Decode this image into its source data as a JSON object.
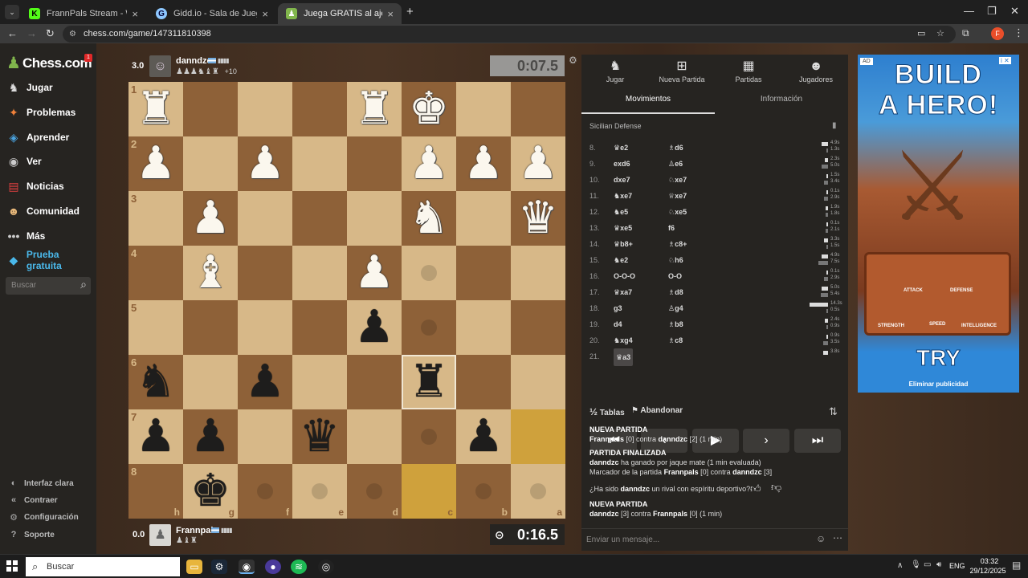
{
  "browser": {
    "tabs": [
      {
        "title": "FrannPals Stream - Watch Live o",
        "icon": "kick-icon",
        "color": "#53fc18"
      },
      {
        "title": "Gidd.io - Sala de Juegos de Fra",
        "icon": "giddio-icon",
        "color": "#8ec8ff"
      },
      {
        "title": "Juega GRATIS al ajedrez online",
        "icon": "chess-pawn-icon",
        "color": "#81b64c"
      }
    ],
    "url": "chess.com/game/147311810398",
    "profile_letter": "F"
  },
  "sidebar": {
    "logo": "Chess.com",
    "notif_badge": "1",
    "items": [
      {
        "label": "Jugar",
        "icon": "play-icon"
      },
      {
        "label": "Problemas",
        "icon": "puzzle-icon"
      },
      {
        "label": "Aprender",
        "icon": "learn-icon"
      },
      {
        "label": "Ver",
        "icon": "watch-icon"
      },
      {
        "label": "Noticias",
        "icon": "news-icon"
      },
      {
        "label": "Comunidad",
        "icon": "community-icon"
      },
      {
        "label": "Más",
        "icon": "more-icon"
      },
      {
        "label": "Prueba gratuita",
        "icon": "diamond-icon"
      }
    ],
    "search_placeholder": "Buscar",
    "bottom": [
      {
        "label": "Interfaz clara",
        "icon": "light-mode-icon"
      },
      {
        "label": "Contraer",
        "icon": "collapse-icon"
      },
      {
        "label": "Configuración",
        "icon": "settings-icon"
      },
      {
        "label": "Soporte",
        "icon": "help-icon"
      }
    ]
  },
  "top_player": {
    "name": "danndzc",
    "eval": "3.0",
    "clock": "0:07.5",
    "captured_extra": "+10"
  },
  "bottom_player": {
    "name": "Frannpals",
    "eval": "0.0",
    "clock": "0:16.5"
  },
  "board": {
    "rank_labels": [
      "1",
      "2",
      "3",
      "4",
      "5",
      "6",
      "7",
      "8"
    ],
    "file_labels": [
      "h",
      "g",
      "f",
      "e",
      "d",
      "c",
      "b",
      "a"
    ],
    "pieces": [
      {
        "sq": "0-0",
        "p": "♜",
        "c": "w"
      },
      {
        "sq": "0-4",
        "p": "♜",
        "c": "w"
      },
      {
        "sq": "0-5",
        "p": "♚",
        "c": "w"
      },
      {
        "sq": "1-0",
        "p": "♟",
        "c": "w"
      },
      {
        "sq": "1-2",
        "p": "♟",
        "c": "w"
      },
      {
        "sq": "1-5",
        "p": "♟",
        "c": "w"
      },
      {
        "sq": "1-6",
        "p": "♟",
        "c": "w"
      },
      {
        "sq": "1-7",
        "p": "♟",
        "c": "w"
      },
      {
        "sq": "2-1",
        "p": "♟",
        "c": "w"
      },
      {
        "sq": "2-5",
        "p": "♞",
        "c": "w"
      },
      {
        "sq": "2-7",
        "p": "♛",
        "c": "w"
      },
      {
        "sq": "3-1",
        "p": "♝",
        "c": "w"
      },
      {
        "sq": "3-4",
        "p": "♟",
        "c": "w"
      },
      {
        "sq": "4-4",
        "p": "♟",
        "c": "b"
      },
      {
        "sq": "5-0",
        "p": "♞",
        "c": "b"
      },
      {
        "sq": "5-2",
        "p": "♟",
        "c": "b"
      },
      {
        "sq": "5-5",
        "p": "♜",
        "c": "b"
      },
      {
        "sq": "6-0",
        "p": "♟",
        "c": "b"
      },
      {
        "sq": "6-1",
        "p": "♟",
        "c": "b"
      },
      {
        "sq": "6-3",
        "p": "♛",
        "c": "b"
      },
      {
        "sq": "6-6",
        "p": "♟",
        "c": "b"
      },
      {
        "sq": "7-1",
        "p": "♚",
        "c": "b"
      }
    ],
    "highlight": [
      "7-5",
      "6-7"
    ],
    "selected": "5-5",
    "hints": [
      "3-5",
      "4-5",
      "6-5",
      "7-3",
      "7-4",
      "7-6",
      "7-7",
      "7-2"
    ]
  },
  "panel": {
    "tabs": [
      {
        "label": "Jugar",
        "icon": "play-icon"
      },
      {
        "label": "Nueva Partida",
        "icon": "plus-icon"
      },
      {
        "label": "Partidas",
        "icon": "board-icon"
      },
      {
        "label": "Jugadores",
        "icon": "players-icon"
      }
    ],
    "subtabs": [
      "Movimientos",
      "Información"
    ],
    "opening": "Sicilian Defense",
    "moves": [
      {
        "n": "8.",
        "w": "♛e2",
        "b": "♗d6",
        "t1": "4.9s",
        "t2": "1.3s"
      },
      {
        "n": "9.",
        "w": "exd6",
        "b": "♙e6",
        "t1": "2.3s",
        "t2": "5.0s"
      },
      {
        "n": "10.",
        "w": "dxe7",
        "b": "♘xe7",
        "t1": "1.5s",
        "t2": "3.4s"
      },
      {
        "n": "11.",
        "w": "♞xe7",
        "b": "♕xe7",
        "t1": "0.1s",
        "t2": "2.9s"
      },
      {
        "n": "12.",
        "w": "♞e5",
        "b": "♘xe5",
        "t1": "1.9s",
        "t2": "1.8s"
      },
      {
        "n": "13.",
        "w": "♛xe5",
        "b": "f6",
        "t1": "0.1s",
        "t2": "2.1s"
      },
      {
        "n": "14.",
        "w": "♛b8+",
        "b": "♗c8+",
        "t1": "3.3s",
        "t2": "1.5s"
      },
      {
        "n": "15.",
        "w": "♞e2",
        "b": "♘h6",
        "t1": "4.9s",
        "t2": "7.5s"
      },
      {
        "n": "16.",
        "w": "O-O-O",
        "b": "O-O",
        "t1": "0.1s",
        "t2": "2.9s"
      },
      {
        "n": "17.",
        "w": "♛xa7",
        "b": "♗d8",
        "t1": "5.0s",
        "t2": "5.4s"
      },
      {
        "n": "18.",
        "w": "g3",
        "b": "♙g4",
        "t1": "14.3s",
        "t2": "0.5s"
      },
      {
        "n": "19.",
        "w": "d4",
        "b": "♗b8",
        "t1": "2.4s",
        "t2": "0.9s"
      },
      {
        "n": "20.",
        "w": "♞xg4",
        "b": "♗c8",
        "t1": "0.9s",
        "t2": "3.5s"
      },
      {
        "n": "21.",
        "w": "♛a3",
        "b": "",
        "t1": "3.8s",
        "t2": ""
      }
    ],
    "tablas": "Tablas",
    "abandonar": "Abandonar",
    "chat": {
      "l1": "NUEVA PARTIDA",
      "l2a": "Frannpals",
      "l2b": " [0] contra ",
      "l2c": "danndzc",
      "l2d": " [2] (1 min)",
      "l3": "PARTIDA FINALIZADA",
      "l4a": "danndzc",
      "l4b": " ha ganado por jaque mate (1 min evaluada)",
      "l5a": "Marcador de la partida ",
      "l5b": "Frannpals",
      "l5c": " [0] contra ",
      "l5d": "danndzc",
      "l5e": " [3]",
      "l6a": "¿Ha sido ",
      "l6b": "danndzc",
      "l6c": " un rival con espíritu deportivo?",
      "l7": "NUEVA PARTIDA",
      "l8a": "danndzc",
      "l8b": " [3] contra ",
      "l8c": "Frannpals",
      "l8d": " [0] (1 min)",
      "placeholder": "Enviar un mensaje..."
    }
  },
  "ad": {
    "label": "AD",
    "title1": "BUILD",
    "title2": "A HERO!",
    "stats": [
      "ATTACK",
      "DEFENSE",
      "STRENGTH",
      "SPEED",
      "INTELLIGENCE"
    ],
    "cta": "TRY",
    "remove": "Eliminar publicidad"
  },
  "taskbar": {
    "search": "Buscar",
    "lang": "ENG",
    "time": "03:32",
    "date": "29/12/2025"
  }
}
